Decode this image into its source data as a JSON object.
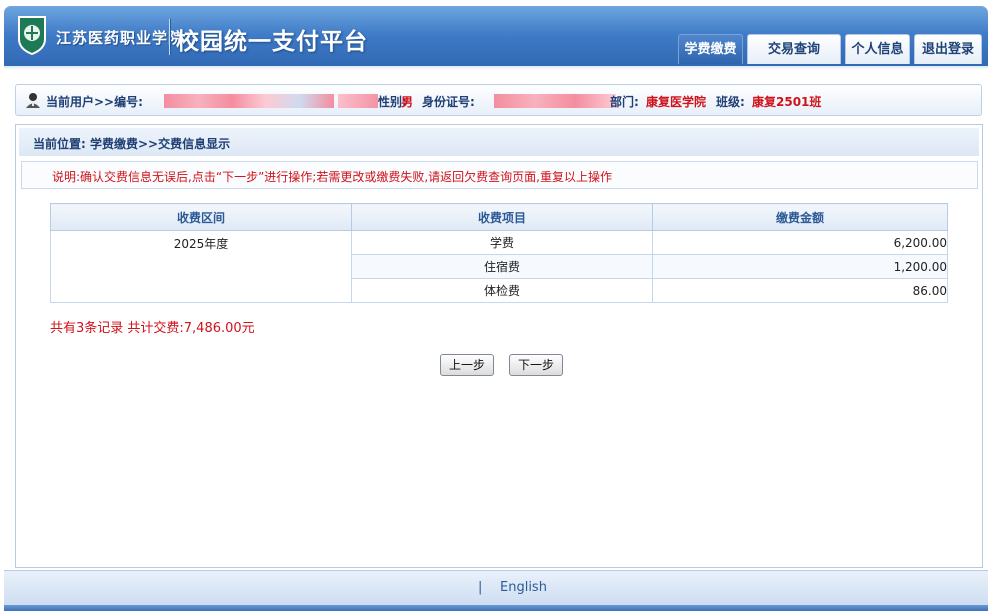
{
  "header": {
    "college_name": "江苏医药职业学院",
    "platform_title": "校园统一支付平台",
    "nav": [
      {
        "label": "学费缴费",
        "active": true
      },
      {
        "label": "交易查询",
        "active": false
      },
      {
        "label": "个人信息",
        "active": false
      },
      {
        "label": "退出登录",
        "active": false
      }
    ]
  },
  "user_bar": {
    "current_user_label": "当前用户>>编号:",
    "gender_label": "性别:",
    "gender_value": "男",
    "id_label": "身份证号:",
    "dept_label": "部门:",
    "dept_value": "康复医学院",
    "class_label": "班级:",
    "class_value": "康复2501班"
  },
  "breadcrumb": "当前位置: 学费缴费>>交费信息显示",
  "notice": "说明:确认交费信息无误后,点击“下一步”进行操作;若需更改或缴费失败,请返回欠费查询页面,重复以上操作",
  "table": {
    "headers": [
      "收费区间",
      "收费项目",
      "缴费金额"
    ],
    "period": "2025年度",
    "rows": [
      {
        "item": "学费",
        "amount": "6,200.00"
      },
      {
        "item": "住宿费",
        "amount": "1,200.00"
      },
      {
        "item": "体检费",
        "amount": "86.00"
      }
    ]
  },
  "summary": "共有3条记录 共计交费:7,486.00元",
  "buttons": {
    "prev": "上一步",
    "next": "下一步"
  },
  "footer": {
    "separator": "|",
    "language_link": "English"
  }
}
